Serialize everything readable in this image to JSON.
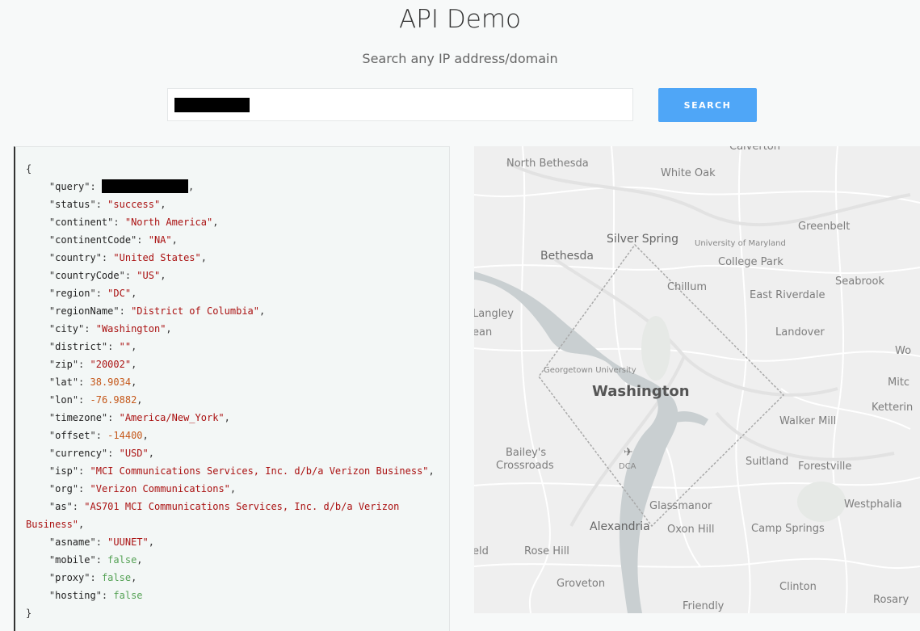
{
  "header": {
    "title": "API Demo",
    "subtitle": "Search any IP address/domain"
  },
  "search": {
    "value": "",
    "button_label": "SEARCH"
  },
  "json_response": {
    "open_brace": "{",
    "close_brace": "}",
    "fields": [
      {
        "key": "query",
        "value": "",
        "type": "redacted"
      },
      {
        "key": "status",
        "value": "\"success\"",
        "type": "str"
      },
      {
        "key": "continent",
        "value": "\"North America\"",
        "type": "str"
      },
      {
        "key": "continentCode",
        "value": "\"NA\"",
        "type": "str"
      },
      {
        "key": "country",
        "value": "\"United States\"",
        "type": "str"
      },
      {
        "key": "countryCode",
        "value": "\"US\"",
        "type": "str"
      },
      {
        "key": "region",
        "value": "\"DC\"",
        "type": "str"
      },
      {
        "key": "regionName",
        "value": "\"District of Columbia\"",
        "type": "str"
      },
      {
        "key": "city",
        "value": "\"Washington\"",
        "type": "str"
      },
      {
        "key": "district",
        "value": "\"\"",
        "type": "str"
      },
      {
        "key": "zip",
        "value": "\"20002\"",
        "type": "str"
      },
      {
        "key": "lat",
        "value": "38.9034",
        "type": "num"
      },
      {
        "key": "lon",
        "value": "-76.9882",
        "type": "num"
      },
      {
        "key": "timezone",
        "value": "\"America/New_York\"",
        "type": "str"
      },
      {
        "key": "offset",
        "value": "-14400",
        "type": "num"
      },
      {
        "key": "currency",
        "value": "\"USD\"",
        "type": "str"
      },
      {
        "key": "isp",
        "value": "\"MCI Communications Services, Inc. d/b/a Verizon Business\"",
        "type": "str"
      },
      {
        "key": "org",
        "value": "\"Verizon Communications\"",
        "type": "str"
      },
      {
        "key": "as",
        "value": "\"AS701 MCI Communications Services, Inc. d/b/a Verizon",
        "value_cont": "Business\"",
        "type": "str"
      },
      {
        "key": "asname",
        "value": "\"UUNET\"",
        "type": "str"
      },
      {
        "key": "mobile",
        "value": "false",
        "type": "bool"
      },
      {
        "key": "proxy",
        "value": "false",
        "type": "bool"
      },
      {
        "key": "hosting",
        "value": "false",
        "type": "bool",
        "last": true
      }
    ]
  },
  "map": {
    "labels": [
      {
        "text": "Calverton",
        "name": "calverton"
      },
      {
        "text": "North Bethesda",
        "name": "north-bethesda"
      },
      {
        "text": "White Oak",
        "name": "white-oak"
      },
      {
        "text": "Greenbelt",
        "name": "greenbelt"
      },
      {
        "text": "Silver Spring",
        "name": "silver-spring"
      },
      {
        "text": "University of Maryland",
        "name": "university-of-maryland"
      },
      {
        "text": "Bethesda",
        "name": "bethesda"
      },
      {
        "text": "College Park",
        "name": "college-park"
      },
      {
        "text": "Seabrook",
        "name": "seabrook"
      },
      {
        "text": "Chillum",
        "name": "chillum"
      },
      {
        "text": "East Riverdale",
        "name": "east-riverdale"
      },
      {
        "text": "Langley",
        "name": "langley"
      },
      {
        "text": "ean",
        "name": "ean"
      },
      {
        "text": "Landover",
        "name": "landover"
      },
      {
        "text": "Wo",
        "name": "wo"
      },
      {
        "text": "Georgetown University",
        "name": "georgetown-university"
      },
      {
        "text": "Mitc",
        "name": "mitc"
      },
      {
        "text": "Washington",
        "name": "washington"
      },
      {
        "text": "Ketterin",
        "name": "ketterin"
      },
      {
        "text": "Walker Mill",
        "name": "walker-mill"
      },
      {
        "text": "Bailey's",
        "name": "baileys"
      },
      {
        "text": "Crossroads",
        "name": "crossroads"
      },
      {
        "text": "DCA",
        "name": "dca"
      },
      {
        "text": "Suitland",
        "name": "suitland"
      },
      {
        "text": "Forestville",
        "name": "forestville"
      },
      {
        "text": "Glassmanor",
        "name": "glassmanor"
      },
      {
        "text": "Westphalia",
        "name": "westphalia"
      },
      {
        "text": "Alexandria",
        "name": "alexandria"
      },
      {
        "text": "Oxon Hill",
        "name": "oxon-hill"
      },
      {
        "text": "Camp Springs",
        "name": "camp-springs"
      },
      {
        "text": "eld",
        "name": "eld"
      },
      {
        "text": "Rose Hill",
        "name": "rose-hill"
      },
      {
        "text": "Groveton",
        "name": "groveton"
      },
      {
        "text": "Clinton",
        "name": "clinton"
      },
      {
        "text": "Rosary",
        "name": "rosary"
      },
      {
        "text": "Friendly",
        "name": "friendly"
      }
    ]
  }
}
